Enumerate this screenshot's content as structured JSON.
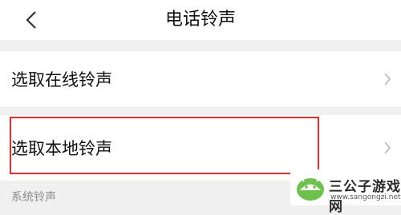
{
  "header": {
    "title": "电话铃声",
    "back_icon": "chevron-left-icon"
  },
  "rows": [
    {
      "label": "选取在线铃声",
      "icon": "chevron-right-icon"
    },
    {
      "label": "选取本地铃声",
      "icon": "chevron-right-icon",
      "highlighted": true
    }
  ],
  "section": {
    "title": "系统铃声"
  },
  "watermark": {
    "name": "三公子游戏网",
    "url": "www.sangongzi.net"
  },
  "colors": {
    "highlight": "#e52d2d",
    "background": "#f0f0f0",
    "watermark_green": "#6cc24a"
  }
}
